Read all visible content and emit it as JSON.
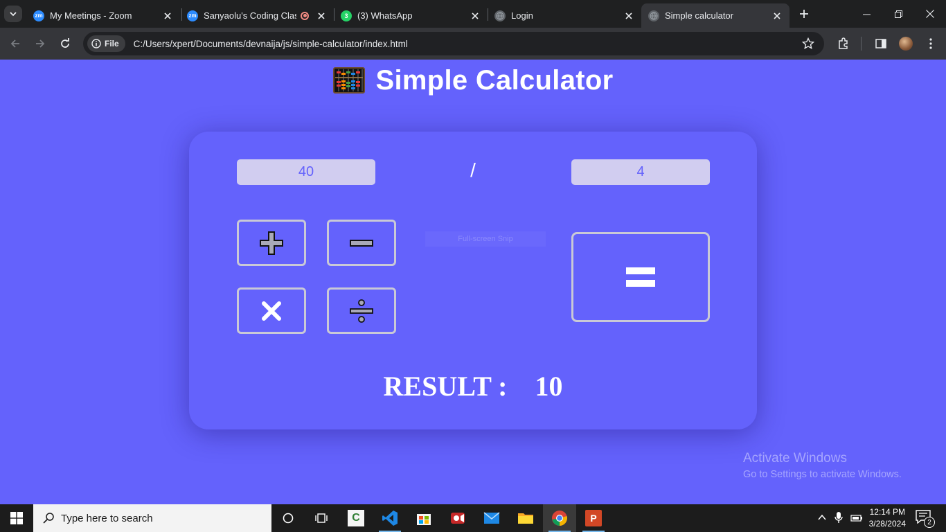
{
  "browser": {
    "tabs": [
      {
        "title": "My Meetings - Zoom",
        "favicon": "zoom-icon"
      },
      {
        "title": "Sanyaolu's Coding Class",
        "favicon": "zoom-icon",
        "recording": true
      },
      {
        "title": "(3) WhatsApp",
        "favicon": "whatsapp-icon",
        "badge": "3"
      },
      {
        "title": "Login",
        "favicon": "globe-icon"
      },
      {
        "title": "Simple calculator",
        "favicon": "globe-icon",
        "active": true
      }
    ],
    "address": {
      "scheme_chip": "File",
      "url": "C:/Users/xpert/Documents/devnaija/js/simple-calculator/index.html"
    }
  },
  "page": {
    "title": "Simple Calculator",
    "calculator": {
      "first_number": "40",
      "operator": "/",
      "second_number": "4",
      "buttons": [
        "add",
        "subtract",
        "multiply",
        "divide",
        "equals"
      ],
      "result_label": "RESULT :",
      "result_value": "10"
    },
    "snip_overlay": "Full-screen Snip"
  },
  "watermark": {
    "line1": "Activate Windows",
    "line2": "Go to Settings to activate Windows."
  },
  "taskbar": {
    "search_placeholder": "Type here to search",
    "time": "12:14 PM",
    "date": "3/28/2024",
    "notification_count": "2"
  },
  "colors": {
    "page_background": "#6462fc",
    "input_background": "#d1cdf0",
    "tab_strip": "#1f2021",
    "toolbar": "#35363a"
  }
}
